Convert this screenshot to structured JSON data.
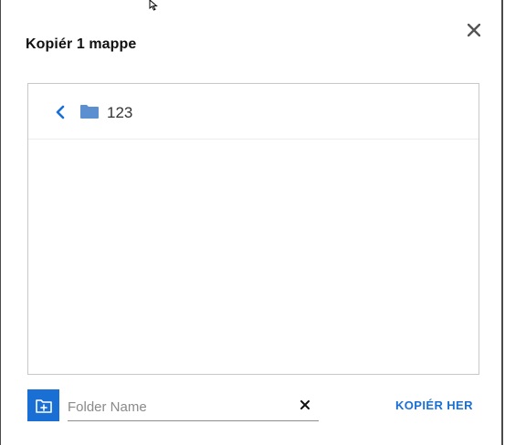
{
  "dialog": {
    "title": "Kopiér 1 mappe",
    "close_icon": "close-icon"
  },
  "browser": {
    "back_icon": "chevron-left-icon",
    "folder_icon": "folder-icon",
    "current_folder": "123"
  },
  "footer": {
    "new_folder_icon": "new-folder-icon",
    "folder_name_placeholder": "Folder Name",
    "folder_name_value": "",
    "clear_icon": "clear-icon",
    "copy_here_label": "KOPIÉR HER"
  },
  "colors": {
    "accent": "#1a6fd4",
    "folder": "#5b8fcf",
    "border": "#c8c8c8"
  }
}
